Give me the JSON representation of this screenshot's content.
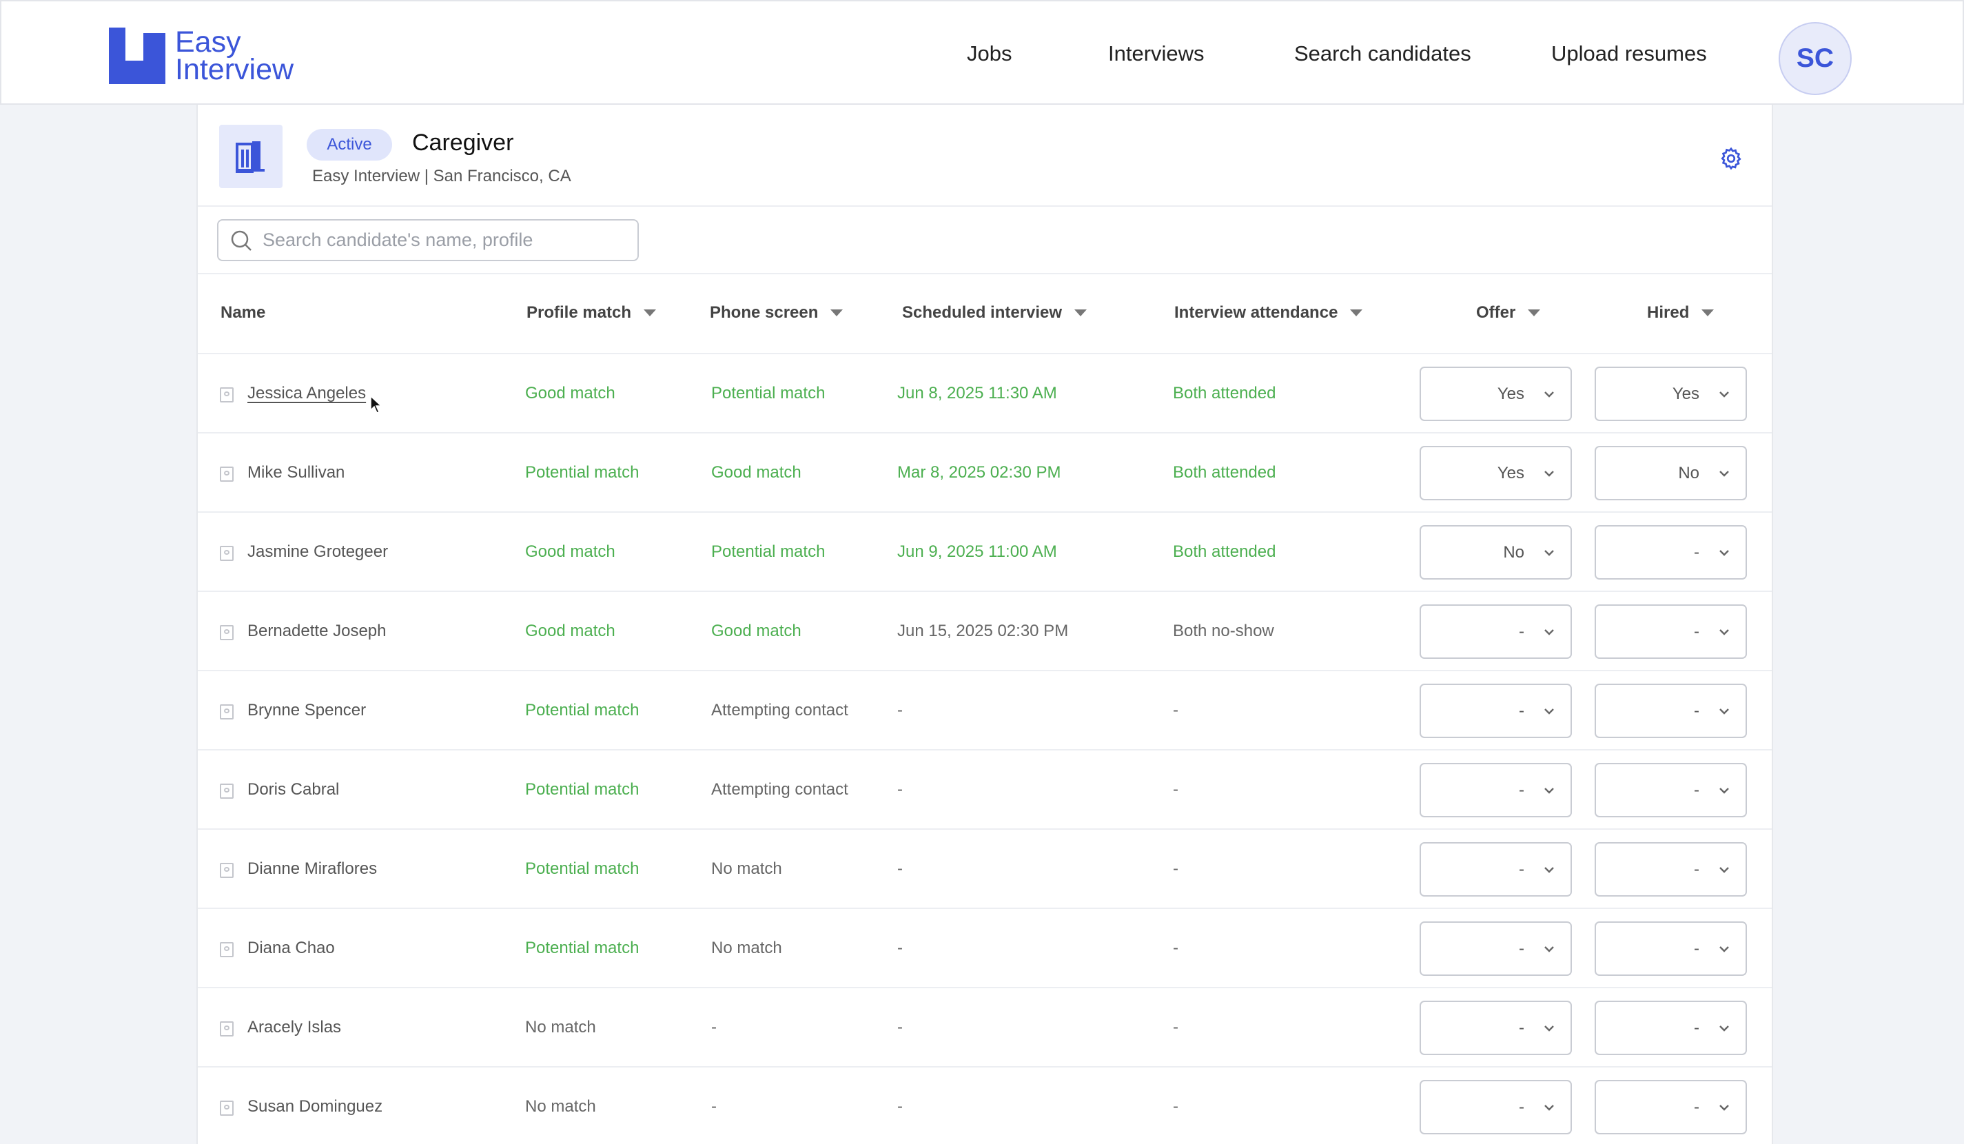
{
  "app": {
    "logo_line1": "Easy",
    "logo_line2": "Interview",
    "brand_color": "#3b55d9",
    "nav": [
      "Jobs",
      "Interviews",
      "Search candidates",
      "Upload resumes"
    ],
    "user_initials": "SC"
  },
  "job": {
    "status": "Active",
    "title": "Caregiver",
    "subtitle": "Easy Interview | San Francisco, CA",
    "icon": "building-icon"
  },
  "search": {
    "placeholder": "Search candidate's name, profile",
    "value": ""
  },
  "table": {
    "columns": [
      "Name",
      "Profile match",
      "Phone screen",
      "Scheduled interview",
      "Interview attendance",
      "Offer",
      "Hired"
    ],
    "status_green": "#4caf50",
    "rows": [
      {
        "name": "Jessica Angeles",
        "profile": "Good match",
        "phone": "Potential match",
        "interview": "Jun 8, 2025 11:30 AM",
        "attendance": "Both attended",
        "offer": "Yes",
        "hired": "Yes"
      },
      {
        "name": "Mike Sullivan",
        "profile": "Potential match",
        "phone": "Good match",
        "interview": "Mar 8, 2025 02:30 PM",
        "attendance": "Both attended",
        "offer": "Yes",
        "hired": "No"
      },
      {
        "name": "Jasmine Grotegeer",
        "profile": "Good match",
        "phone": "Potential match",
        "interview": "Jun 9, 2025 11:00 AM",
        "attendance": "Both attended",
        "offer": "No",
        "hired": "-"
      },
      {
        "name": "Bernadette Joseph",
        "profile": "Good match",
        "phone": "Good match",
        "interview": "Jun 15, 2025 02:30 PM",
        "attendance": "Both no-show",
        "offer": "-",
        "hired": "-"
      },
      {
        "name": "Brynne Spencer",
        "profile": "Potential match",
        "phone": "Attempting contact",
        "interview": "-",
        "attendance": "-",
        "offer": "-",
        "hired": "-"
      },
      {
        "name": "Doris Cabral",
        "profile": "Potential match",
        "phone": "Attempting contact",
        "interview": "-",
        "attendance": "-",
        "offer": "-",
        "hired": "-"
      },
      {
        "name": "Dianne Miraflores",
        "profile": "Potential match",
        "phone": "No match",
        "interview": "-",
        "attendance": "-",
        "offer": "-",
        "hired": "-"
      },
      {
        "name": "Diana Chao",
        "profile": "Potential match",
        "phone": "No match",
        "interview": "-",
        "attendance": "-",
        "offer": "-",
        "hired": "-"
      },
      {
        "name": "Aracely Islas",
        "profile": "No match",
        "phone": "-",
        "interview": "-",
        "attendance": "-",
        "offer": "-",
        "hired": "-"
      },
      {
        "name": "Susan Dominguez",
        "profile": "No match",
        "phone": "-",
        "interview": "-",
        "attendance": "-",
        "offer": "-",
        "hired": "-"
      }
    ]
  }
}
